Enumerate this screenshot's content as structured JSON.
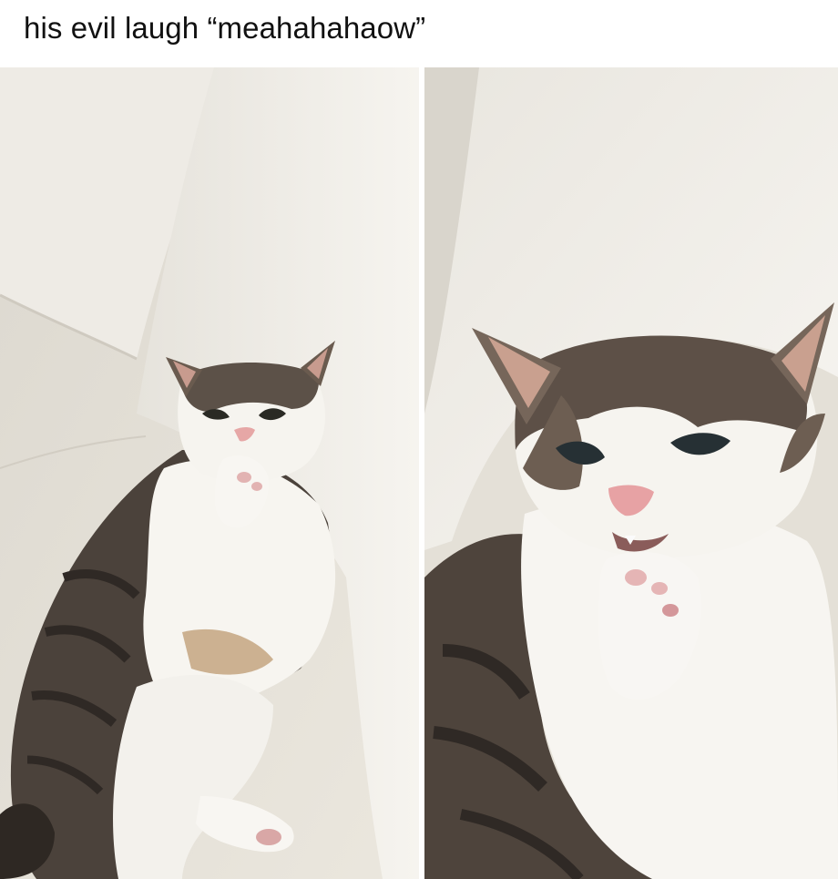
{
  "caption": {
    "text": "his evil laugh “meahahahaow”"
  },
  "panels": [
    {
      "subject": "cat-reclining-on-sofa-paw-to-mouth",
      "colors": {
        "sofa": "#e8e4db",
        "cushion": "#f3f1ec",
        "fur_white": "#f6f4ef",
        "fur_tabby": "#4a413a",
        "nose": "#e6a7a6"
      }
    },
    {
      "subject": "cat-closeup-smirking-paw-to-mouth",
      "colors": {
        "cushion": "#f1efea",
        "fur_white": "#f7f5f1",
        "fur_tabby": "#5a4e44",
        "nose": "#e7a2a4"
      }
    }
  ]
}
